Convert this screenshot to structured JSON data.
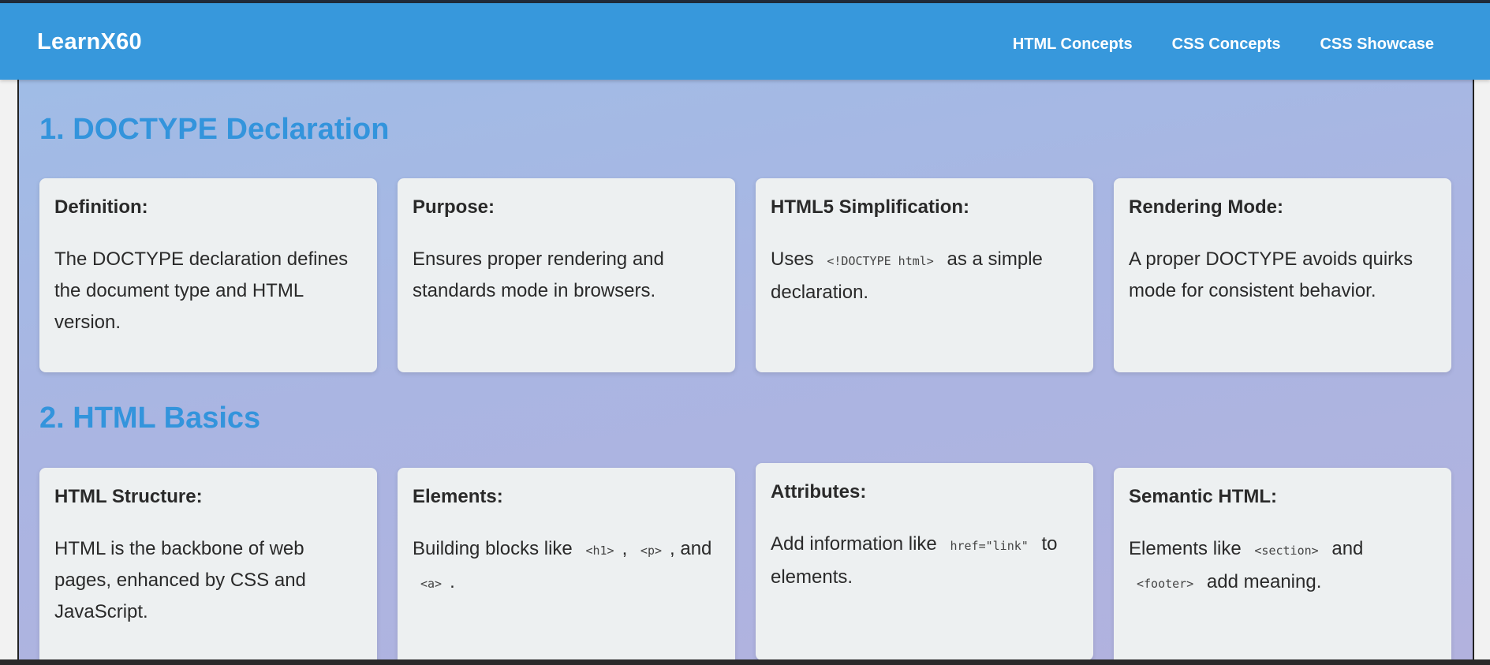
{
  "header": {
    "logo": "LearnX60",
    "nav": [
      "HTML Concepts",
      "CSS Concepts",
      "CSS Showcase"
    ]
  },
  "sections": [
    {
      "title": "1. DOCTYPE Declaration",
      "cards": [
        {
          "heading": "Definition:",
          "text": "The DOCTYPE declaration defines the document type and HTML version."
        },
        {
          "heading": "Purpose:",
          "text": "Ensures proper rendering and standards mode in browsers."
        },
        {
          "heading": "HTML5 Simplification:",
          "pre": "Uses",
          "code": "<!DOCTYPE html>",
          "post": "as a simple declaration."
        },
        {
          "heading": "Rendering Mode:",
          "text": "A proper DOCTYPE avoids quirks mode for consistent behavior."
        }
      ]
    },
    {
      "title": "2. HTML Basics",
      "cards": [
        {
          "heading": "HTML Structure:",
          "text": "HTML is the backbone of web pages, enhanced by CSS and JavaScript."
        },
        {
          "heading": "Elements:",
          "pre": "Building blocks like",
          "code1": "<h1>",
          "sep1": ",",
          "code2": "<p>",
          "sep2": ", and",
          "code3": "<a>",
          "post": "."
        },
        {
          "heading": "Attributes:",
          "pre": "Add information like",
          "code": "href=\"link\"",
          "post": "to elements."
        },
        {
          "heading": "Semantic HTML:",
          "pre": "Elements like",
          "code1": "<section>",
          "mid": "and",
          "code2": "<footer>",
          "post": "add meaning."
        }
      ]
    }
  ],
  "colors": {
    "header_bg": "#3798dc",
    "section_title": "#3394dc",
    "card_bg": "#edf0f1"
  }
}
